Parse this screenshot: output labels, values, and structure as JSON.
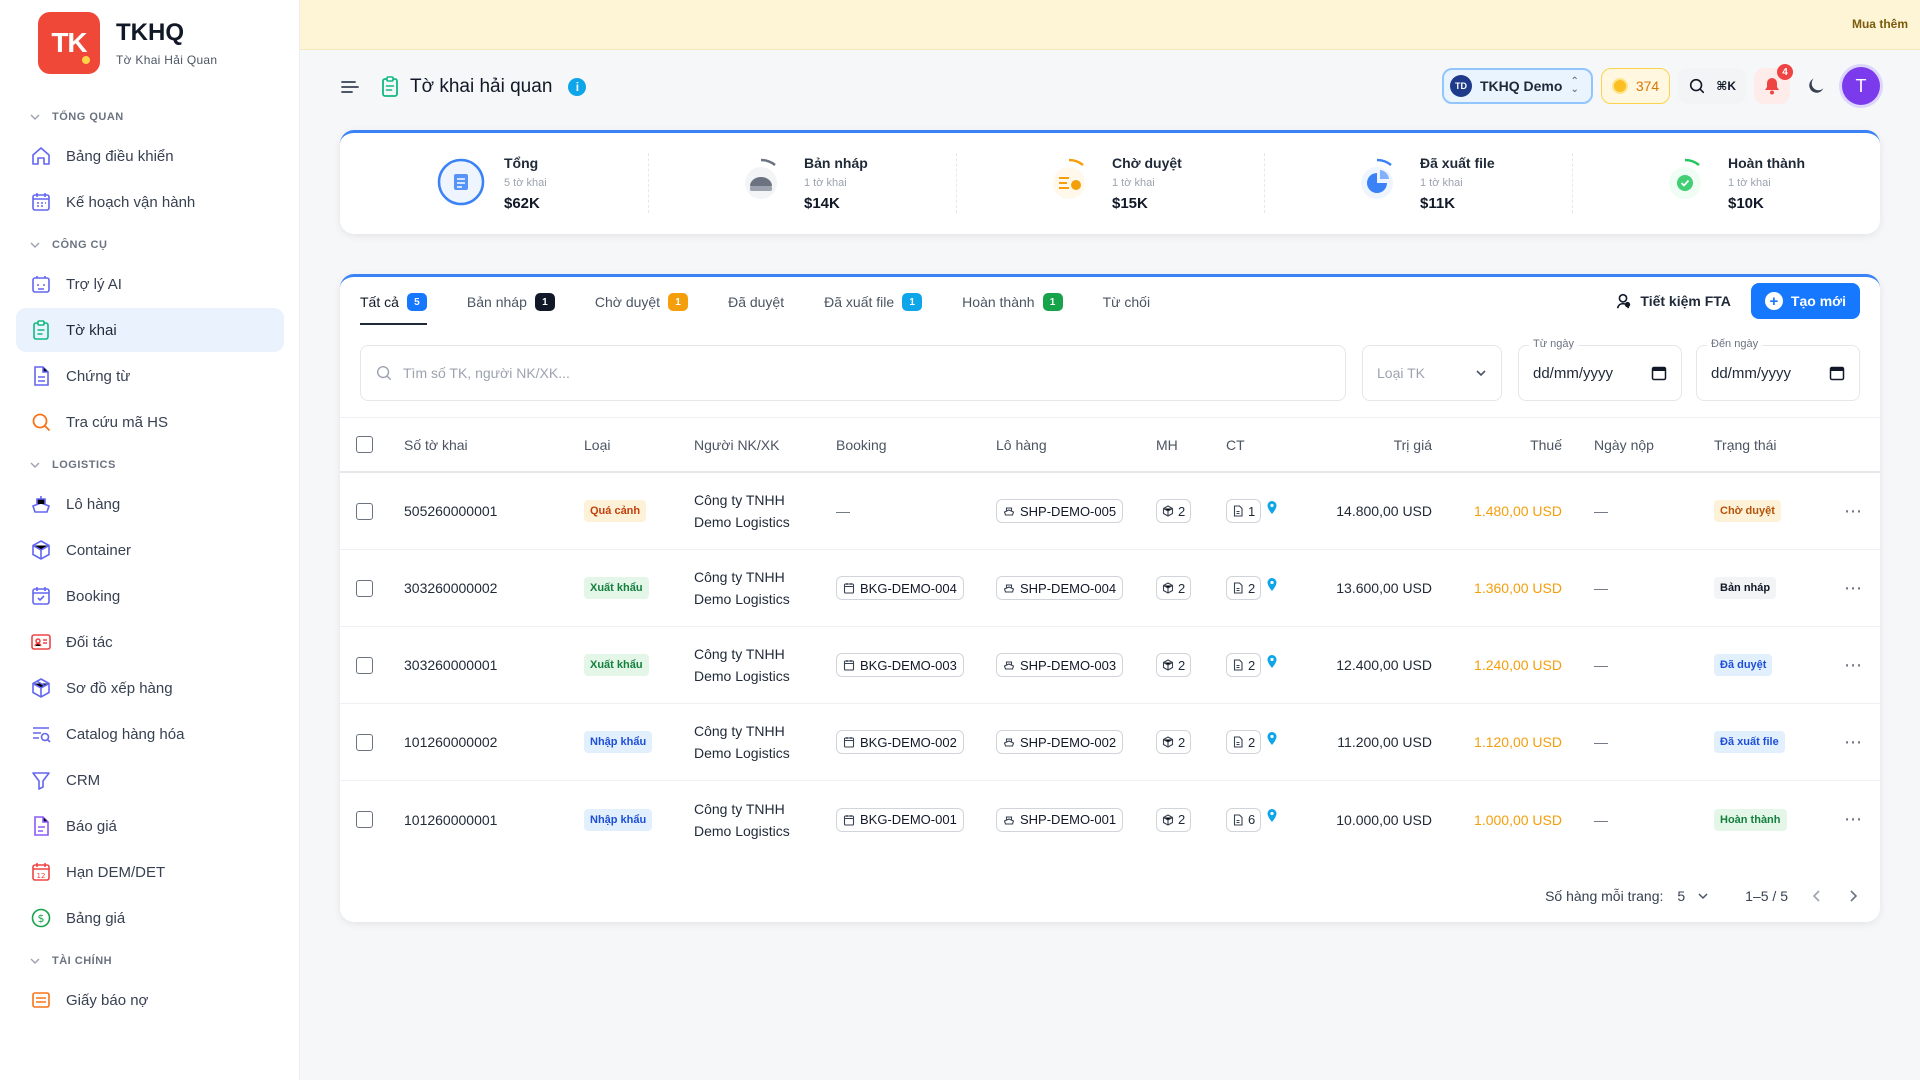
{
  "brand": {
    "logo": "TK",
    "name": "TKHQ",
    "subtitle": "Tờ Khai Hải Quan"
  },
  "sidebar": {
    "sections": [
      {
        "title": "TỔNG QUAN",
        "items": [
          {
            "label": "Bảng điều khiển",
            "icon": "home-icon"
          },
          {
            "label": "Kế hoạch vận hành",
            "icon": "calendar-icon"
          }
        ]
      },
      {
        "title": "CÔNG CỤ",
        "items": [
          {
            "label": "Trợ lý AI",
            "icon": "ai-icon"
          },
          {
            "label": "Tờ khai",
            "icon": "clipboard-icon",
            "active": true
          },
          {
            "label": "Chứng từ",
            "icon": "document-icon"
          },
          {
            "label": "Tra cứu mã HS",
            "icon": "search-icon"
          }
        ]
      },
      {
        "title": "LOGISTICS",
        "items": [
          {
            "label": "Lô hàng",
            "icon": "ship-icon"
          },
          {
            "label": "Container",
            "icon": "container-icon"
          },
          {
            "label": "Booking",
            "icon": "booking-icon"
          },
          {
            "label": "Đối tác",
            "icon": "contact-card-icon"
          },
          {
            "label": "Sơ đồ xếp hàng",
            "icon": "box-icon"
          },
          {
            "label": "Catalog hàng hóa",
            "icon": "catalog-search-icon"
          },
          {
            "label": "CRM",
            "icon": "funnel-icon"
          },
          {
            "label": "Báo giá",
            "icon": "quote-icon"
          },
          {
            "label": "Hạn DEM/DET",
            "icon": "calendar-12-icon"
          },
          {
            "label": "Bảng giá",
            "icon": "dollar-circle-icon"
          }
        ]
      },
      {
        "title": "TÀI CHÍNH",
        "items": [
          {
            "label": "Giấy báo nợ",
            "icon": "invoice-icon"
          }
        ]
      }
    ]
  },
  "banner": {
    "buy_more": "Mua thêm"
  },
  "header": {
    "title": "Tờ khai hải quan",
    "info": "i",
    "org_initials": "TD",
    "org_name": "TKHQ Demo",
    "coins": "374",
    "shortcut": "⌘K",
    "notifications": "4",
    "avatar": "T"
  },
  "stats": [
    {
      "label": "Tổng",
      "sub": "5 tờ khai",
      "value": "$62K",
      "color": "#3b82f6",
      "icon": "list-icon"
    },
    {
      "label": "Bản nháp",
      "sub": "1 tờ khai",
      "value": "$14K",
      "color": "#6b7280",
      "icon": "draft-icon"
    },
    {
      "label": "Chờ duyệt",
      "sub": "1 tờ khai",
      "value": "$15K",
      "color": "#f59e0b",
      "icon": "pending-icon"
    },
    {
      "label": "Đã xuất file",
      "sub": "1 tờ khai",
      "value": "$11K",
      "color": "#3b82f6",
      "icon": "pie-icon"
    },
    {
      "label": "Hoàn thành",
      "sub": "1 tờ khai",
      "value": "$10K",
      "color": "#22c55e",
      "icon": "check-icon"
    }
  ],
  "tabs": [
    {
      "label": "Tất cả",
      "count": "5",
      "color": "#1677ff",
      "active": true
    },
    {
      "label": "Bản nháp",
      "count": "1",
      "color": "#111827"
    },
    {
      "label": "Chờ duyệt",
      "count": "1",
      "color": "#f59e0b"
    },
    {
      "label": "Đã duyệt",
      "count": ""
    },
    {
      "label": "Đã xuất file",
      "count": "1",
      "color": "#0ea5e9"
    },
    {
      "label": "Hoàn thành",
      "count": "1",
      "color": "#16a34a"
    },
    {
      "label": "Từ chối",
      "count": ""
    }
  ],
  "actions": {
    "fta": "Tiết kiệm FTA",
    "create": "Tạo mới"
  },
  "filters": {
    "search_placeholder": "Tìm số TK, người NK/XK...",
    "type_placeholder": "Loại TK",
    "from_label": "Từ ngày",
    "from_value": "dd/mm/yyyy",
    "to_label": "Đến ngày",
    "to_value": "dd/mm/yyyy"
  },
  "table": {
    "columns": {
      "no": "Số tờ khai",
      "type": "Loại",
      "party": "Người NK/XK",
      "booking": "Booking",
      "shipment": "Lô hàng",
      "mh": "MH",
      "ct": "CT",
      "value": "Trị giá",
      "tax": "Thuế",
      "date": "Ngày nộp",
      "status": "Trạng thái"
    },
    "rows": [
      {
        "no": "505260000001",
        "type": "Quá cảnh",
        "type_class": "t-transit",
        "party": "Công ty TNHH Demo Logistics",
        "booking": "—",
        "shipment": "SHP-DEMO-005",
        "mh": "2",
        "ct": "1",
        "value": "14.800,00 USD",
        "tax": "1.480,00 USD",
        "date": "—",
        "status": "Chờ duyệt",
        "status_class": "st-wait"
      },
      {
        "no": "303260000002",
        "type": "Xuất khẩu",
        "type_class": "t-export",
        "party": "Công ty TNHH Demo Logistics",
        "booking": "BKG-DEMO-004",
        "shipment": "SHP-DEMO-004",
        "mh": "2",
        "ct": "2",
        "value": "13.600,00 USD",
        "tax": "1.360,00 USD",
        "date": "—",
        "status": "Bản nháp",
        "status_class": "st-draft"
      },
      {
        "no": "303260000001",
        "type": "Xuất khẩu",
        "type_class": "t-export",
        "party": "Công ty TNHH Demo Logistics",
        "booking": "BKG-DEMO-003",
        "shipment": "SHP-DEMO-003",
        "mh": "2",
        "ct": "2",
        "value": "12.400,00 USD",
        "tax": "1.240,00 USD",
        "date": "—",
        "status": "Đã duyệt",
        "status_class": "st-ok"
      },
      {
        "no": "101260000002",
        "type": "Nhập khẩu",
        "type_class": "t-import",
        "party": "Công ty TNHH Demo Logistics",
        "booking": "BKG-DEMO-002",
        "shipment": "SHP-DEMO-002",
        "mh": "2",
        "ct": "2",
        "value": "11.200,00 USD",
        "tax": "1.120,00 USD",
        "date": "—",
        "status": "Đã xuất file",
        "status_class": "st-file"
      },
      {
        "no": "101260000001",
        "type": "Nhập khẩu",
        "type_class": "t-import",
        "party": "Công ty TNHH Demo Logistics",
        "booking": "BKG-DEMO-001",
        "shipment": "SHP-DEMO-001",
        "mh": "2",
        "ct": "6",
        "value": "10.000,00 USD",
        "tax": "1.000,00 USD",
        "date": "—",
        "status": "Hoàn thành",
        "status_class": "st-done"
      }
    ]
  },
  "pagination": {
    "rows_label": "Số hàng mỗi trang:",
    "rows_value": "5",
    "range": "1–5 / 5"
  }
}
